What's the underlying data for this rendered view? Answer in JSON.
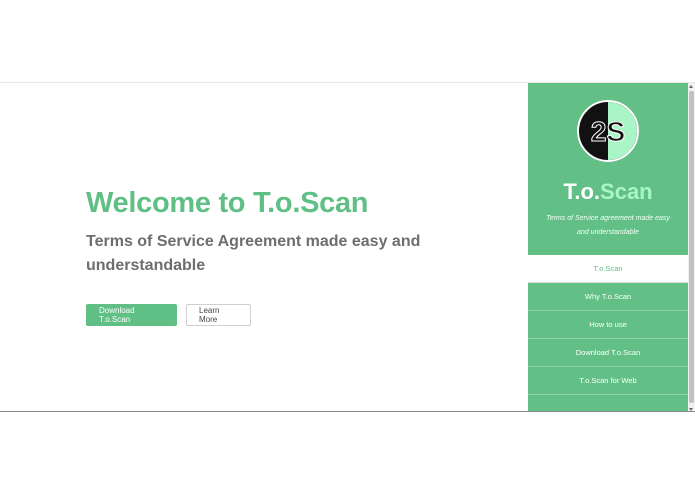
{
  "hero": {
    "title": "Welcome to T.o.Scan",
    "subtitle": "Terms of Service Agreement made easy and understandable",
    "download_label": "Download T.o.Scan",
    "learn_more_label": "Learn More"
  },
  "sidebar": {
    "logo_text": "2S",
    "brand_prefix": "T.o.",
    "brand_accent": "Scan",
    "tagline": "Terms of Service agreement made easy and understandable",
    "nav": [
      {
        "label": "T.o.Scan",
        "active": true
      },
      {
        "label": "Why T.o.Scan",
        "active": false
      },
      {
        "label": "How to use",
        "active": false
      },
      {
        "label": "Download T.o.Scan",
        "active": false
      },
      {
        "label": "T.o.Scan for Web",
        "active": false
      }
    ]
  },
  "colors": {
    "accent": "#5fbf85",
    "sidebar": "#62c086",
    "accent_light": "#a9f5c6",
    "text_gray": "#6e6e6e"
  }
}
